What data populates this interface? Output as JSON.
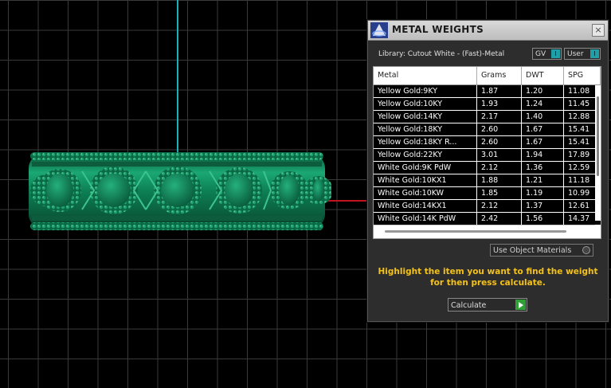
{
  "panel": {
    "title": "METAL WEIGHTS",
    "close_glyph": "×",
    "library_label": "Library: Cutout White - (Fast)-Metal",
    "gv_toggle": "GV",
    "user_toggle": "User",
    "toggle_knob": "I",
    "columns": [
      "Metal",
      "Grams",
      "DWT",
      "SPG"
    ],
    "rows": [
      [
        "Yellow Gold:9KY",
        "1.87",
        "1.20",
        "11.08"
      ],
      [
        "Yellow Gold:10KY",
        "1.93",
        "1.24",
        "11.45"
      ],
      [
        "Yellow Gold:14KY",
        "2.17",
        "1.40",
        "12.88"
      ],
      [
        "Yellow Gold:18KY",
        "2.60",
        "1.67",
        "15.41"
      ],
      [
        "Yellow Gold:18KY R...",
        "2.60",
        "1.67",
        "15.41"
      ],
      [
        "Yellow Gold:22KY",
        "3.01",
        "1.94",
        "17.89"
      ],
      [
        "White Gold:9K PdW",
        "2.12",
        "1.36",
        "12.59"
      ],
      [
        "White Gold:10KX1",
        "1.88",
        "1.21",
        "11.18"
      ],
      [
        "White Gold:10KW",
        "1.85",
        "1.19",
        "10.99"
      ],
      [
        "White Gold:14KX1",
        "2.12",
        "1.37",
        "12.61"
      ],
      [
        "White Gold:14K PdW",
        "2.42",
        "1.56",
        "14.37"
      ]
    ],
    "use_object_materials": "Use Object Materials",
    "instruction": "Highlight the item you want to find the weight for then press calculate.",
    "calculate_label": "Calculate"
  },
  "colors": {
    "ring": "#0f7a52",
    "axis_vertical": "#19b0b8",
    "axis_horizontal": "#c0141c",
    "instruction_text": "#f4c21a"
  },
  "icons": {
    "app_logo": "app-logo-icon",
    "close": "close-icon",
    "calculate_go": "play-arrow-icon"
  }
}
